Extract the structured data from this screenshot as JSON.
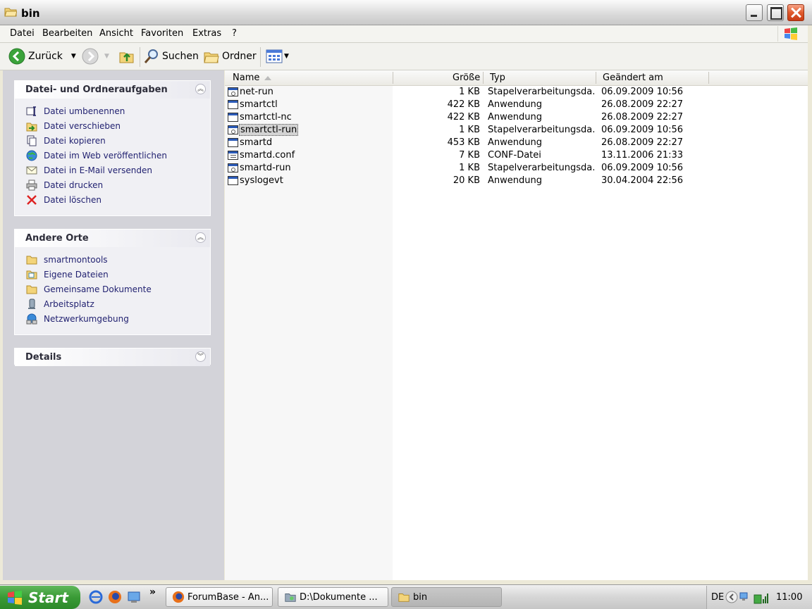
{
  "window": {
    "title": "bin",
    "controls": {
      "minimize": "minimize",
      "maximize": "maximize",
      "close": "close"
    }
  },
  "menu": [
    "Datei",
    "Bearbeiten",
    "Ansicht",
    "Favoriten",
    "Extras",
    "?"
  ],
  "toolbar": {
    "back": "Zurück",
    "search": "Suchen",
    "folders": "Ordner"
  },
  "tasks_panel": {
    "title": "Datei- und Ordneraufgaben",
    "items": [
      {
        "label": "Datei umbenennen",
        "icon": "rename-icon"
      },
      {
        "label": "Datei verschieben",
        "icon": "move-icon"
      },
      {
        "label": "Datei kopieren",
        "icon": "copy-icon"
      },
      {
        "label": "Datei im Web veröffentlichen",
        "icon": "web-publish-icon"
      },
      {
        "label": "Datei in E-Mail versenden",
        "icon": "email-icon"
      },
      {
        "label": "Datei drucken",
        "icon": "print-icon"
      },
      {
        "label": "Datei löschen",
        "icon": "delete-icon"
      }
    ]
  },
  "places_panel": {
    "title": "Andere Orte",
    "items": [
      {
        "label": "smartmontools",
        "icon": "folder-icon"
      },
      {
        "label": "Eigene Dateien",
        "icon": "my-documents-icon"
      },
      {
        "label": "Gemeinsame Dokumente",
        "icon": "folder-icon"
      },
      {
        "label": "Arbeitsplatz",
        "icon": "my-computer-icon"
      },
      {
        "label": "Netzwerkumgebung",
        "icon": "network-icon"
      }
    ]
  },
  "details_panel": {
    "title": "Details"
  },
  "columns": {
    "name": "Name",
    "size": "Größe",
    "type": "Typ",
    "modified": "Geändert am"
  },
  "files": [
    {
      "name": "net-run",
      "size": "1 KB",
      "type": "Stapelverarbeitungsda...",
      "modified": "06.09.2009 10:56",
      "kind": "bat"
    },
    {
      "name": "smartctl",
      "size": "422 KB",
      "type": "Anwendung",
      "modified": "26.08.2009 22:27",
      "kind": "exe"
    },
    {
      "name": "smartctl-nc",
      "size": "422 KB",
      "type": "Anwendung",
      "modified": "26.08.2009 22:27",
      "kind": "exe"
    },
    {
      "name": "smartctl-run",
      "size": "1 KB",
      "type": "Stapelverarbeitungsda...",
      "modified": "06.09.2009 10:56",
      "kind": "bat",
      "selected": true
    },
    {
      "name": "smartd",
      "size": "453 KB",
      "type": "Anwendung",
      "modified": "26.08.2009 22:27",
      "kind": "exe"
    },
    {
      "name": "smartd.conf",
      "size": "7 KB",
      "type": "CONF-Datei",
      "modified": "13.11.2006 21:33",
      "kind": "conf"
    },
    {
      "name": "smartd-run",
      "size": "1 KB",
      "type": "Stapelverarbeitungsda...",
      "modified": "06.09.2009 10:56",
      "kind": "bat"
    },
    {
      "name": "syslogevt",
      "size": "20 KB",
      "type": "Anwendung",
      "modified": "30.04.2004 22:56",
      "kind": "exe"
    }
  ],
  "taskbar": {
    "start": "Start",
    "tasks": [
      {
        "label": "ForumBase - An...",
        "icon": "firefox-icon"
      },
      {
        "label": "D:\\Dokumente ...",
        "icon": "explorer-icon"
      },
      {
        "label": "bin",
        "icon": "folder-icon",
        "active": true
      }
    ],
    "tray": {
      "lang": "DE",
      "clock": "11:00"
    }
  },
  "colors": {
    "accent_blue": "#1f1f6f",
    "start_green": "#3a9a36",
    "close_red": "#e05a2c"
  }
}
